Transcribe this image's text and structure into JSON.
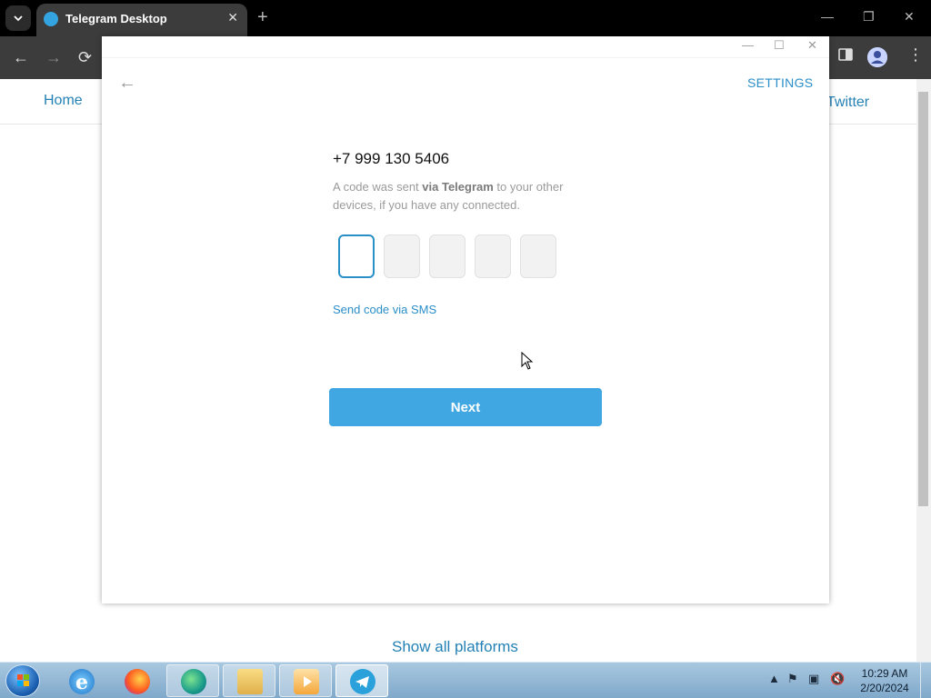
{
  "browser": {
    "tab_title": "Telegram Desktop",
    "tab_close": "✕",
    "new_tab": "+",
    "window_controls": {
      "minimize": "—",
      "restore": "❐",
      "close": "✕"
    },
    "nav": {
      "back": "←",
      "forward": "→",
      "reload": "⟳"
    },
    "menu": "⋮",
    "sidepanel_icon": "sidebar-icon",
    "profile_icon": "profile-icon"
  },
  "page": {
    "nav_home": "Home",
    "nav_twitter": "Twitter",
    "footer_link": "Show all platforms"
  },
  "telegram": {
    "window_controls": {
      "minimize": "—",
      "maximize": "☐",
      "close": "✕"
    },
    "back": "←",
    "settings_label": "SETTINGS",
    "phone": "+7 999 130 5406",
    "desc_prefix": "A code was sent ",
    "desc_bold": "via Telegram",
    "desc_suffix": " to your other devices, if you have any connected.",
    "code_length": 5,
    "sms_link": "Send code via SMS",
    "next_label": "Next",
    "accent": "#40a7e3"
  },
  "taskbar": {
    "items": [
      {
        "name": "internet-explorer",
        "state": "pinned"
      },
      {
        "name": "firefox",
        "state": "pinned"
      },
      {
        "name": "edge",
        "state": "open"
      },
      {
        "name": "file-explorer",
        "state": "open"
      },
      {
        "name": "media-player",
        "state": "open"
      },
      {
        "name": "telegram",
        "state": "active"
      }
    ],
    "time": "10:29 AM",
    "date": "2/20/2024"
  }
}
